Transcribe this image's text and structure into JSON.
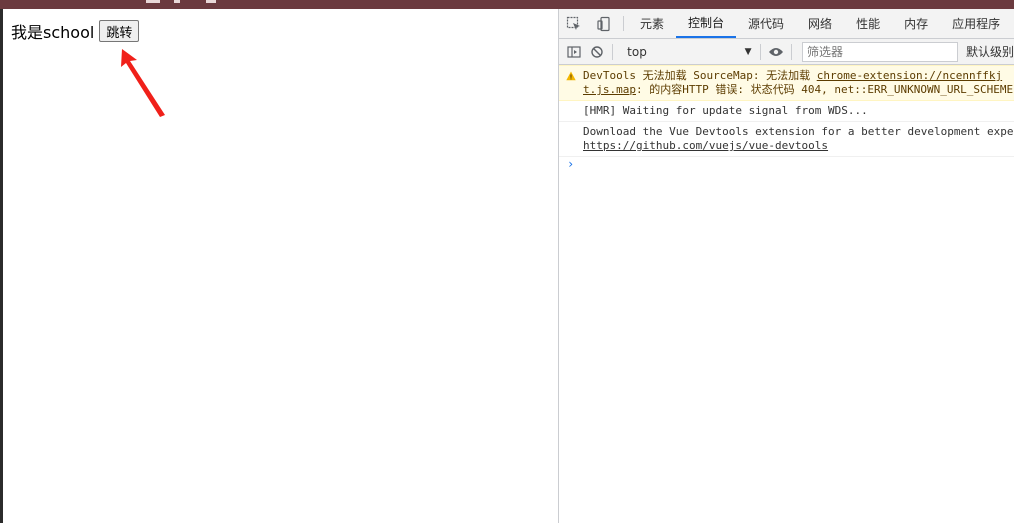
{
  "page": {
    "heading": "我是school",
    "jump_button": "跳转"
  },
  "devtools": {
    "tabs": [
      {
        "label": "元素"
      },
      {
        "label": "控制台"
      },
      {
        "label": "源代码"
      },
      {
        "label": "网络"
      },
      {
        "label": "性能"
      },
      {
        "label": "内存"
      },
      {
        "label": "应用程序"
      }
    ],
    "active_tab": "控制台",
    "toolbar": {
      "context": "top",
      "filter_placeholder": "筛选器",
      "levels": "默认级别"
    },
    "console": {
      "warning_line1_prefix": "DevTools 无法加载 SourceMap: 无法加载 ",
      "warning_line1_link": "chrome-extension://ncennffkj",
      "warning_line2_link": "t.js.map",
      "warning_line2_rest": ": 的内容HTTP 错误: 状态代码 404, net::ERR_UNKNOWN_URL_SCHEME",
      "hmr_line": "[HMR] Waiting for update signal from WDS...",
      "vue_line1": "Download the Vue Devtools extension for a better development exper",
      "vue_line2": "https://github.com/vuejs/vue-devtools"
    }
  },
  "colors": {
    "accent": "#1a73e8",
    "warning_bg": "#fffbe5",
    "arrow": "#f0201a"
  }
}
